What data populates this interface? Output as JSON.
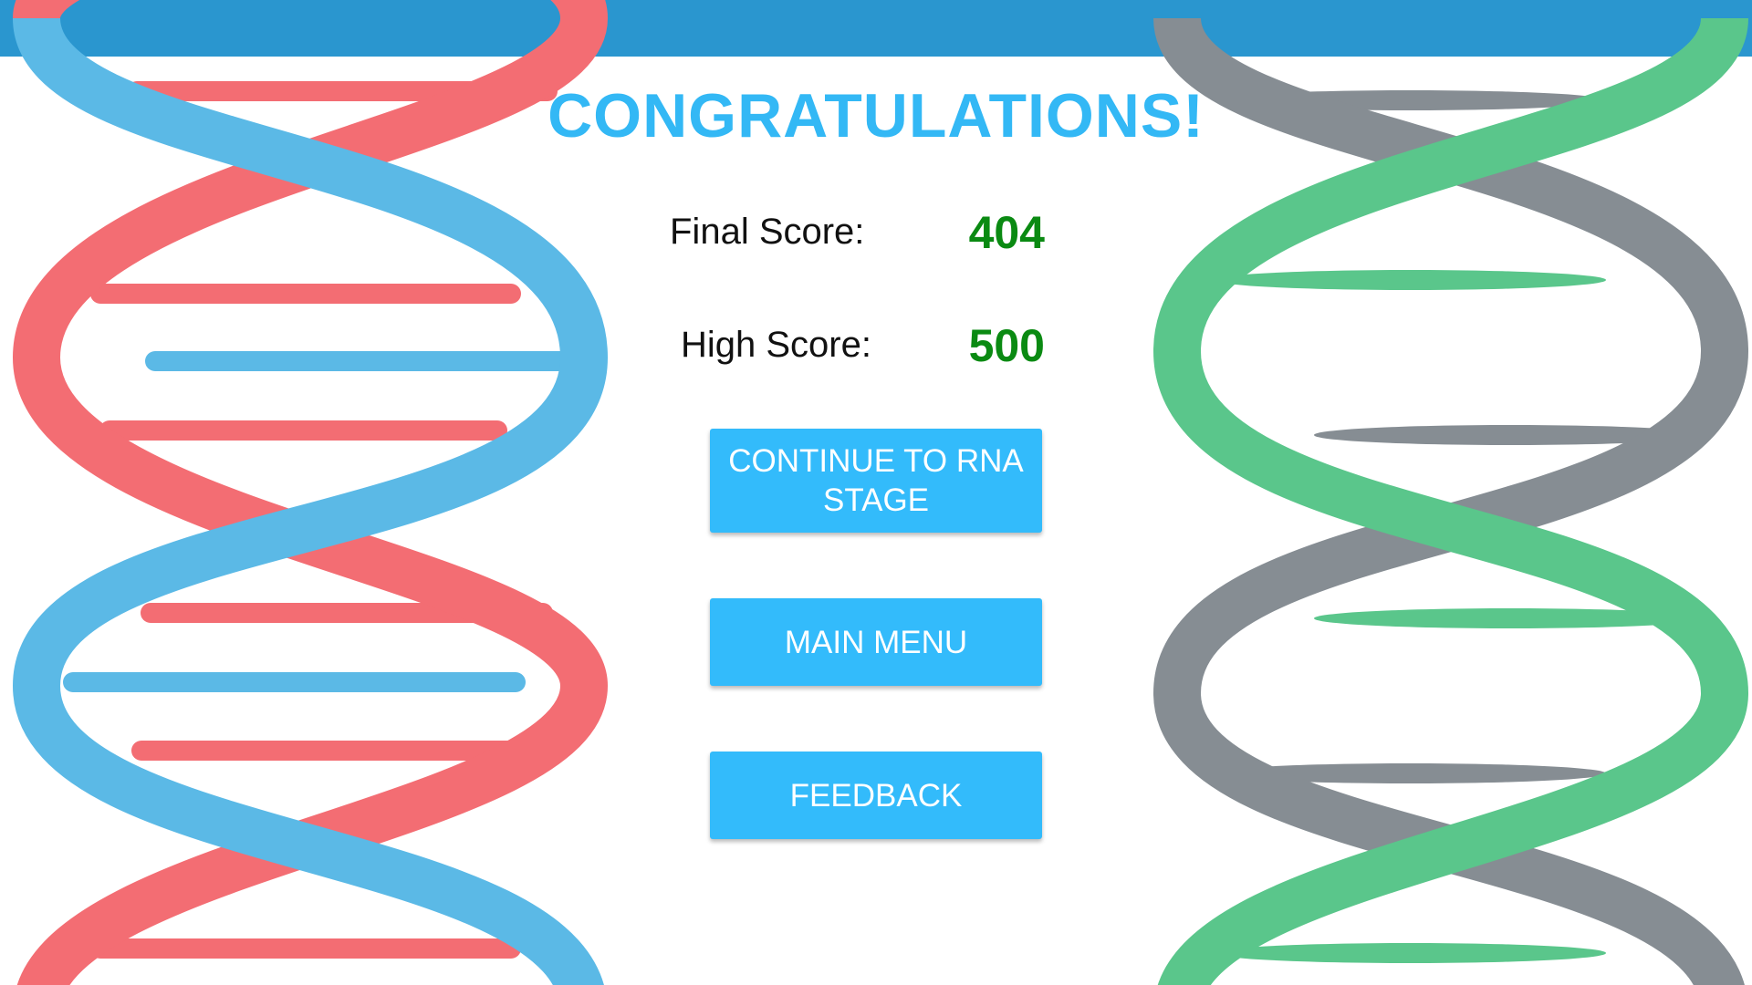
{
  "header": {
    "bar_color": "#2a96cf"
  },
  "title": "CONGRATULATIONS!",
  "scores": {
    "final_label": "Final Score:",
    "final_value": "404",
    "high_label": "High Score:",
    "high_value": "500"
  },
  "buttons": {
    "continue_label": "CONTINUE TO RNA STAGE",
    "main_menu_label": "MAIN MENU",
    "feedback_label": "FEEDBACK"
  },
  "colors": {
    "title": "#33b8f5",
    "score_value": "#0a8a12",
    "button": "#33bbfb",
    "dna_strand_blue": "#5bb9e6",
    "dna_strand_red": "#f36d73",
    "rna_strand_green": "#5ac68b",
    "rna_strand_gray": "#868d93"
  }
}
